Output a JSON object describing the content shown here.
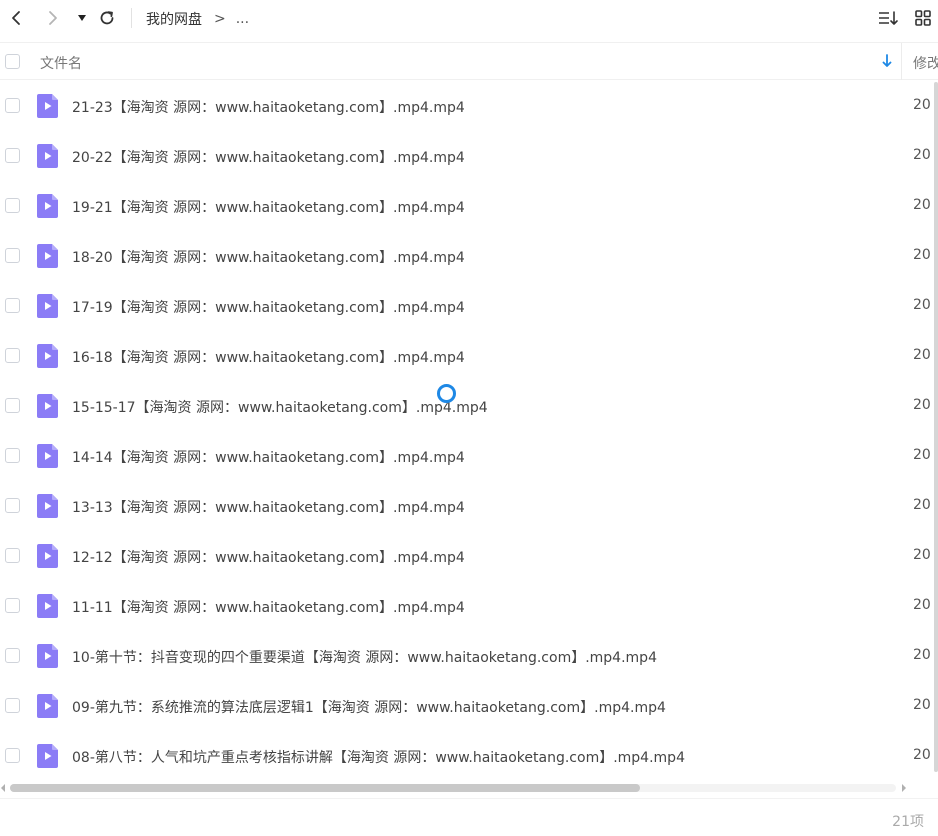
{
  "toolbar": {
    "back_icon": "chevron-left-icon",
    "forward_icon": "chevron-right-icon",
    "dropdown_icon": "caret-down-icon",
    "refresh_icon": "refresh-icon",
    "breadcrumb_root": "我的网盘",
    "breadcrumb_separator": ">",
    "breadcrumb_more": "...",
    "sort_icon": "sort-icon",
    "grid_view_icon": "grid-view-icon"
  },
  "header": {
    "name_label": "文件名",
    "modified_label": "修改",
    "sort_indicator_color": "#1e88e5"
  },
  "files": [
    {
      "name": "21-23【海淘资 源网：www.haitaoketang.com】.mp4.mp4",
      "date": "20"
    },
    {
      "name": "20-22【海淘资 源网：www.haitaoketang.com】.mp4.mp4",
      "date": "20"
    },
    {
      "name": "19-21【海淘资 源网：www.haitaoketang.com】.mp4.mp4",
      "date": "20"
    },
    {
      "name": "18-20【海淘资 源网：www.haitaoketang.com】.mp4.mp4",
      "date": "20"
    },
    {
      "name": "17-19【海淘资 源网：www.haitaoketang.com】.mp4.mp4",
      "date": "20"
    },
    {
      "name": "16-18【海淘资 源网：www.haitaoketang.com】.mp4.mp4",
      "date": "20"
    },
    {
      "name": "15-15-17【海淘资 源网：www.haitaoketang.com】.mp4.mp4",
      "date": "20"
    },
    {
      "name": "14-14【海淘资 源网：www.haitaoketang.com】.mp4.mp4",
      "date": "20"
    },
    {
      "name": "13-13【海淘资 源网：www.haitaoketang.com】.mp4.mp4",
      "date": "20"
    },
    {
      "name": "12-12【海淘资 源网：www.haitaoketang.com】.mp4.mp4",
      "date": "20"
    },
    {
      "name": "11-11【海淘资 源网：www.haitaoketang.com】.mp4.mp4",
      "date": "20"
    },
    {
      "name": "10-第十节：抖音变现的四个重要渠道【海淘资 源网：www.haitaoketang.com】.mp4.mp4",
      "date": "20"
    },
    {
      "name": "09-第九节：系统推流的算法底层逻辑1【海淘资 源网：www.haitaoketang.com】.mp4.mp4",
      "date": "20"
    },
    {
      "name": "08-第八节：人气和坑产重点考核指标讲解【海淘资 源网：www.haitaoketang.com】.mp4.mp4",
      "date": "20"
    }
  ],
  "file_icon": "video-file-icon",
  "file_icon_color": "#8b7cf6",
  "footer": {
    "count": "21项"
  }
}
